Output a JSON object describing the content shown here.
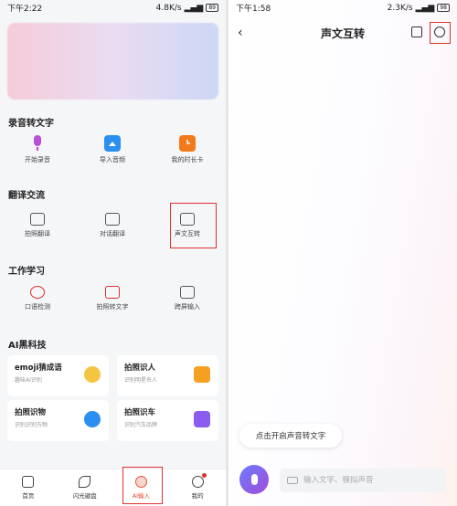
{
  "left": {
    "status": {
      "time": "下午2:22",
      "speed": "4.8K/s",
      "battery": "89"
    },
    "sections": {
      "record": {
        "title": "录音转文字",
        "items": [
          "开始录音",
          "导入音频",
          "我的时长卡"
        ]
      },
      "translate": {
        "title": "翻译交流",
        "items": [
          "拍照翻译",
          "对话翻译",
          "声文互转"
        ]
      },
      "work": {
        "title": "工作学习",
        "items": [
          "口语检测",
          "拍照转文字",
          "跨屏输入"
        ]
      },
      "ai": {
        "title": "AI黑科技",
        "cards": [
          {
            "title": "emoji猜成语",
            "sub": "趣味AI识别"
          },
          {
            "title": "拍照识人",
            "sub": "识别明星名人"
          },
          {
            "title": "拍照识物",
            "sub": "识别识别万物"
          },
          {
            "title": "拍照识车",
            "sub": "识别汽车品牌"
          }
        ]
      }
    },
    "nav": [
      "首页",
      "闪光键盘",
      "AI输入",
      "我的"
    ]
  },
  "right": {
    "status": {
      "time": "下午1:58",
      "speed": "2.3K/s",
      "battery": "98"
    },
    "title": "声文互转",
    "tip": "点击开启声音转文字",
    "input_placeholder": "输入文字、模拟声音"
  },
  "colors": {
    "accent_red": "#e0312e",
    "mic_start": "#6a7cff",
    "mic_end": "#a34bd8"
  }
}
